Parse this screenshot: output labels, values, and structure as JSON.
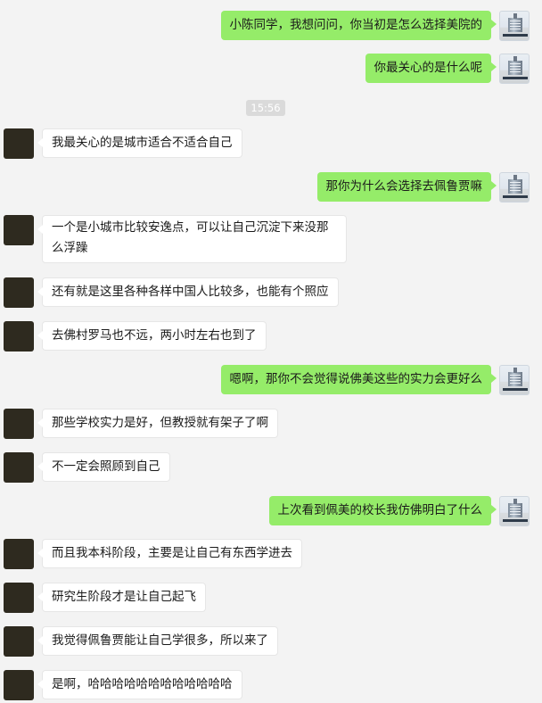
{
  "timestamp": "15:56",
  "messages": [
    {
      "side": "right",
      "text": "小陈同学，我想问问，你当初是怎么选择美院的"
    },
    {
      "side": "right",
      "text": "你最关心的是什么呢"
    },
    {
      "side": "left",
      "text": "我最关心的是城市适合不适合自己"
    },
    {
      "side": "right",
      "text": "那你为什么会选择去佩鲁贾嘛"
    },
    {
      "side": "left",
      "text": "一个是小城市比较安逸点，可以让自己沉淀下来没那么浮躁"
    },
    {
      "side": "left",
      "text": "还有就是这里各种各样中国人比较多，也能有个照应"
    },
    {
      "side": "left",
      "text": "去佛村罗马也不远，两小时左右也到了"
    },
    {
      "side": "right",
      "text": "嗯啊，那你不会觉得说佛美这些的实力会更好么"
    },
    {
      "side": "left",
      "text": "那些学校实力是好，但教授就有架子了啊"
    },
    {
      "side": "left",
      "text": "不一定会照顾到自己"
    },
    {
      "side": "right",
      "text": "上次看到佩美的校长我仿佛明白了什么"
    },
    {
      "side": "left",
      "text": "而且我本科阶段，主要是让自己有东西学进去"
    },
    {
      "side": "left",
      "text": "研究生阶段才是让自己起飞"
    },
    {
      "side": "left",
      "text": "我觉得佩鲁贾能让自己学很多，所以来了"
    },
    {
      "side": "left",
      "text": "是啊，哈哈哈哈哈哈哈哈哈哈哈哈"
    }
  ]
}
